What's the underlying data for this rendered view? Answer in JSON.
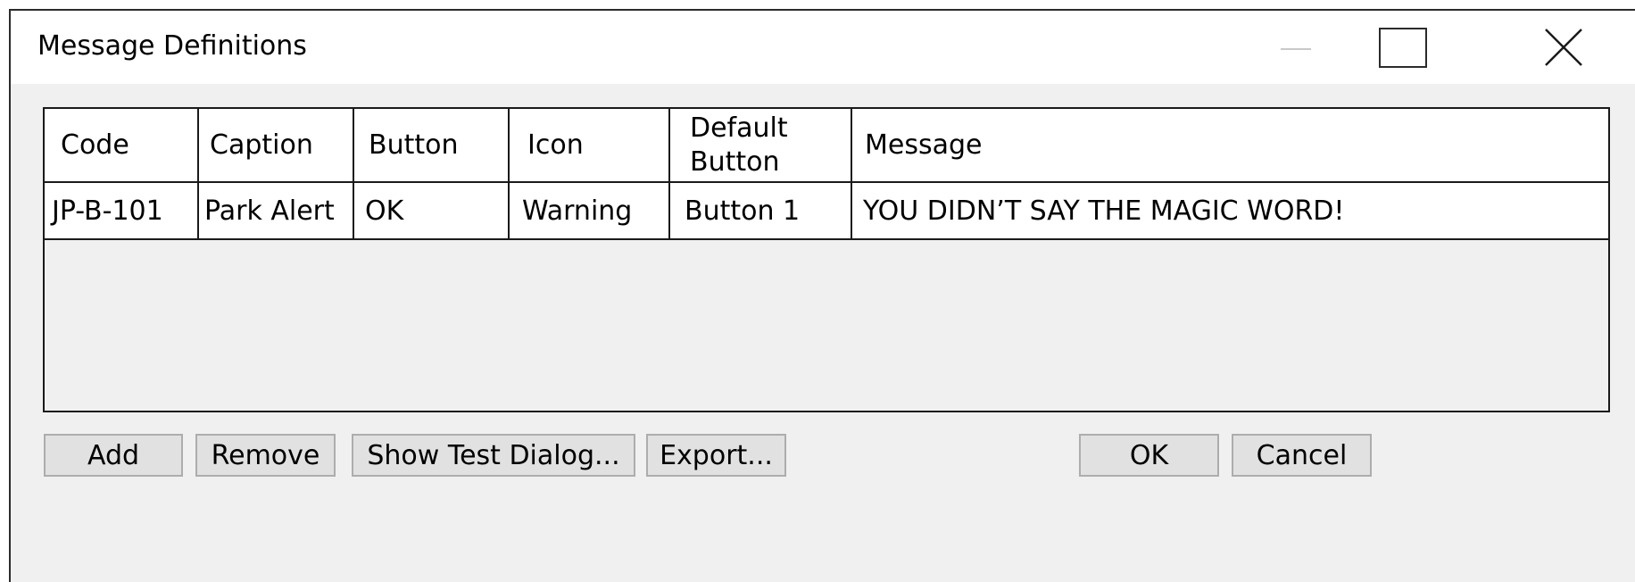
{
  "window": {
    "title": "Message Definitions"
  },
  "grid": {
    "columns": [
      "Code",
      "Caption",
      "Button",
      "Icon",
      "Default Button",
      "Message"
    ],
    "rows": [
      {
        "code": "JP-B-101",
        "caption": "Park Alert",
        "button": "OK",
        "icon": "Warning",
        "default_button": "Button 1",
        "message": "YOU DIDN’T SAY THE MAGIC WORD!"
      }
    ]
  },
  "buttons": {
    "add": "Add",
    "remove": "Remove",
    "show_test_dialog": "Show Test Dialog...",
    "export": "Export...",
    "ok": "OK",
    "cancel": "Cancel"
  },
  "icons": {
    "minimize": "minimize-icon",
    "maximize": "maximize-icon",
    "close": "close-icon"
  },
  "colors": {
    "window_background": "#f0f0f0",
    "titlebar_background": "#ffffff",
    "button_face": "#e1e1e1",
    "button_border": "#adadad",
    "grid_border": "#1a1a1a"
  }
}
